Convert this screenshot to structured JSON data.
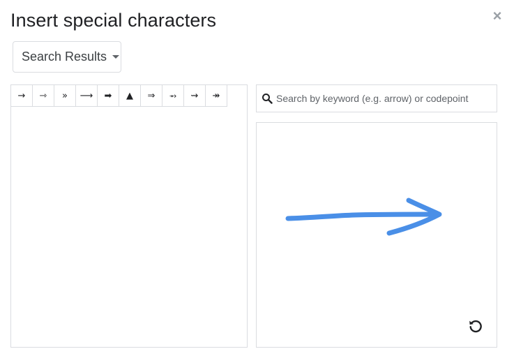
{
  "dialog": {
    "title": "Insert special characters",
    "close_label": "×"
  },
  "category": {
    "selected": "Search Results"
  },
  "results": {
    "characters": [
      "→",
      "⇾",
      "»",
      "⟶",
      "➡",
      "▲",
      "⇒",
      "⥇",
      "⇝",
      "↠"
    ]
  },
  "search": {
    "placeholder": "Search by keyword (e.g. arrow) or codepoint",
    "value": ""
  },
  "drawing": {
    "stroke_color": "#4a8fe7"
  },
  "icons": {
    "search": "search-icon",
    "reset": "reset-icon",
    "caret": "chevron-down-icon"
  }
}
